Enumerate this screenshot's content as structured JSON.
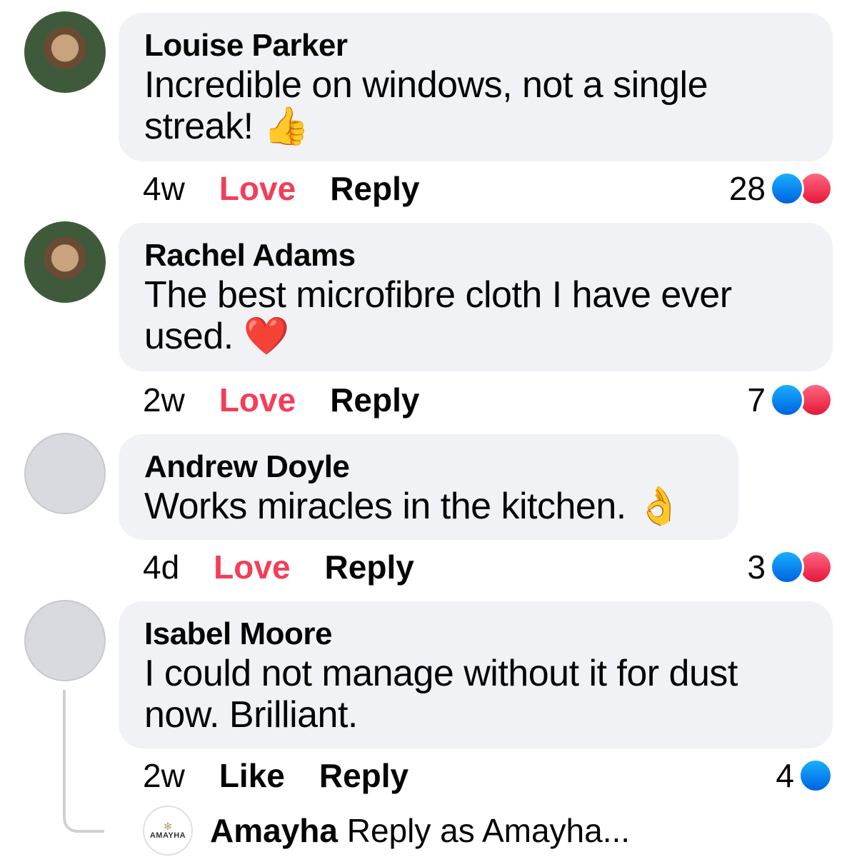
{
  "comments": [
    {
      "author": "Louise Parker",
      "text": "Incredible on windows, not a single streak! 👍",
      "time": "4w",
      "action": "Love",
      "reply": "Reply",
      "count": "28"
    },
    {
      "author": "Rachel Adams",
      "text": "The best microfibre cloth I have ever used. ❤️",
      "time": "2w",
      "action": "Love",
      "reply": "Reply",
      "count": "7"
    },
    {
      "author": "Andrew Doyle",
      "text": "Works miracles in the kitchen. 👌",
      "time": "4d",
      "action": "Love",
      "reply": "Reply",
      "count": "3"
    },
    {
      "author": "Isabel Moore",
      "text": "I could not manage without it for dust now. Brilliant.",
      "time": "2w",
      "action": "Like",
      "reply": "Reply",
      "count": "4"
    }
  ],
  "reply_box": {
    "brand_avatar_text": "AMAYHA",
    "name": "Amayha",
    "prompt": "Reply as Amayha..."
  },
  "colors": {
    "bubble": "#f0f2f5",
    "love": "#f33e58",
    "like_badge": "#1877f2",
    "love_badge": "#e61739"
  }
}
